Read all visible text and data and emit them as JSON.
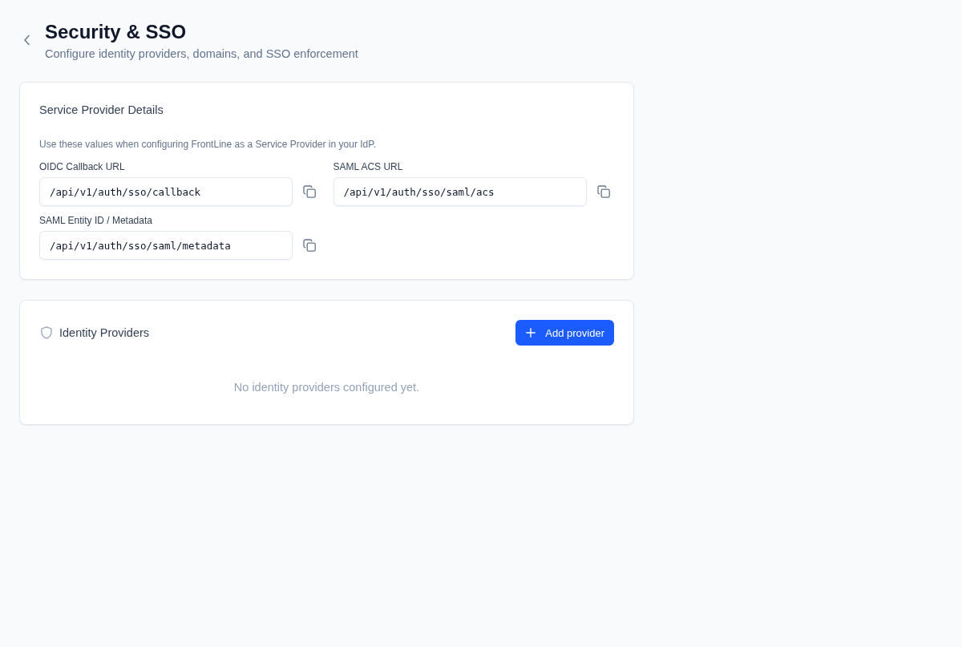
{
  "header": {
    "title": "Security & SSO",
    "subtitle": "Configure identity providers, domains, and SSO enforcement"
  },
  "service_provider": {
    "title": "Service Provider Details",
    "description": "Use these values when configuring FrontLine as a Service Provider in your IdP.",
    "fields": [
      {
        "label": "OIDC Callback URL",
        "value": "/api/v1/auth/sso/callback"
      },
      {
        "label": "SAML ACS URL",
        "value": "/api/v1/auth/sso/saml/acs"
      },
      {
        "label": "SAML Entity ID / Metadata",
        "value": "/api/v1/auth/sso/saml/metadata"
      }
    ]
  },
  "identity_providers": {
    "title": "Identity Providers",
    "add_button": "Add provider",
    "empty_message": "No identity providers configured yet."
  }
}
